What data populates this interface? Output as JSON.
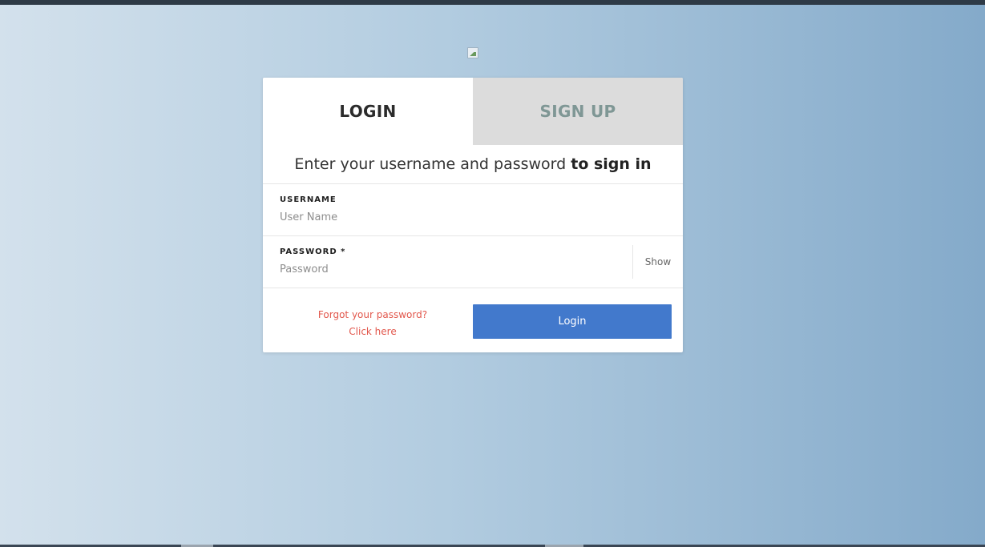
{
  "tabs": {
    "login_label": "LOGIN",
    "signup_label": "SIGN UP"
  },
  "subtitle": {
    "plain": "Enter your username and password",
    "bold": "to sign in"
  },
  "username": {
    "label": "USERNAME",
    "value": "",
    "placeholder": "User Name"
  },
  "password": {
    "label": "PASSWORD *",
    "value": "",
    "placeholder": "Password",
    "show_label": "Show"
  },
  "forgot": {
    "line1": "Forgot your password?",
    "line2": "Click here"
  },
  "login_button_label": "Login",
  "colors": {
    "primary": "#4279cc",
    "link": "#e2574c",
    "inactive_tab_bg": "#dcdcdc",
    "inactive_tab_text": "#7f9795"
  },
  "icons": {
    "logo": "broken-image-icon"
  }
}
